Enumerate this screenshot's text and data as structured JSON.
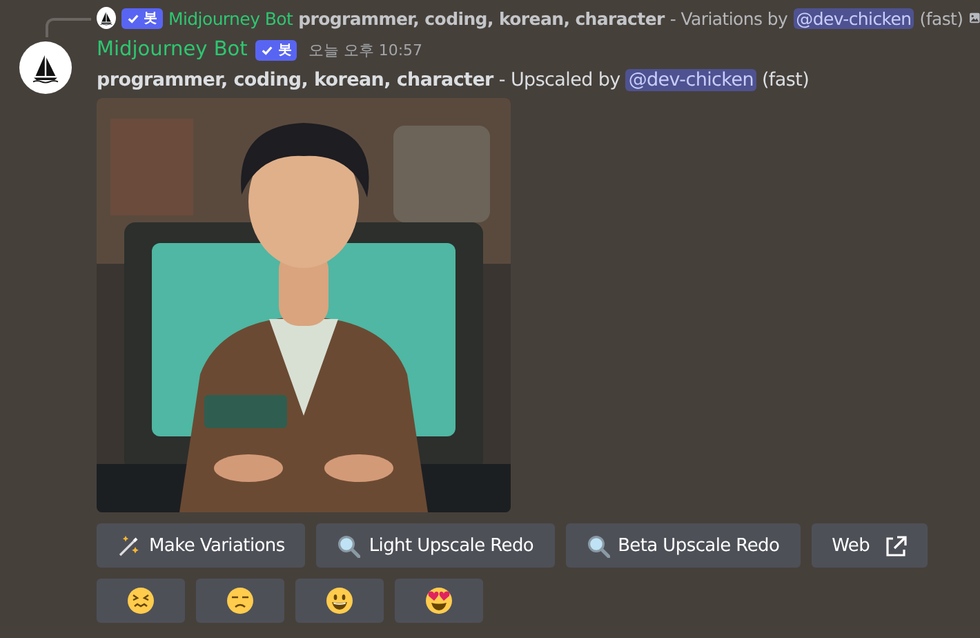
{
  "reply": {
    "author": "Midjourney Bot",
    "badge": "봇",
    "prompt": "programmer, coding, korean, character",
    "suffix": "- Variations by",
    "mention": "@dev-chicken",
    "speed": "(fast)"
  },
  "message": {
    "author": "Midjourney Bot",
    "badge": "봇",
    "timestamp": "오늘 오후 10:57",
    "prompt": "programmer, coding, korean, character",
    "suffix": "- Upscaled by",
    "mention": "@dev-chicken",
    "speed": "(fast)"
  },
  "buttons": [
    {
      "kind": "variations",
      "label": "Make Variations"
    },
    {
      "kind": "upscale",
      "label": "Light Upscale Redo"
    },
    {
      "kind": "upscale",
      "label": "Beta Upscale Redo"
    },
    {
      "kind": "link",
      "label": "Web"
    }
  ],
  "reactions": [
    {
      "kind": "confounded"
    },
    {
      "kind": "unamused"
    },
    {
      "kind": "grinning"
    },
    {
      "kind": "heart-eyes"
    }
  ]
}
